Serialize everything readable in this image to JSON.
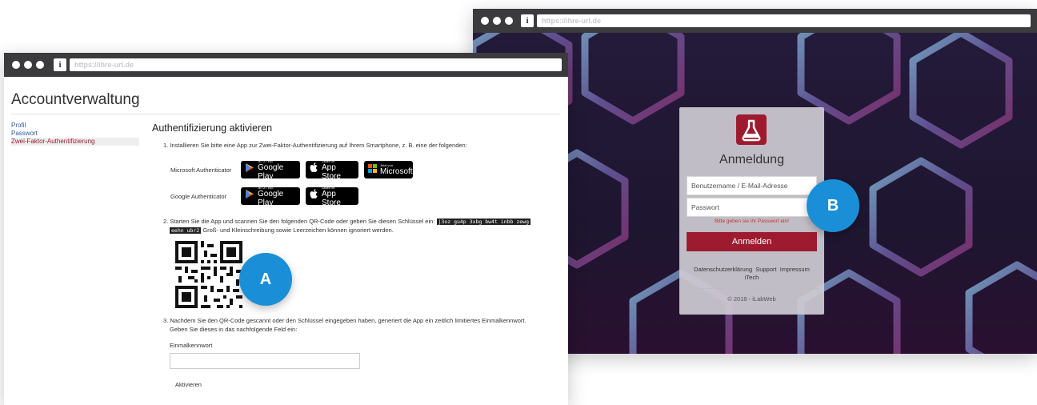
{
  "login_window": {
    "url": "https://ihre-url.de",
    "title": "Anmeldung",
    "username_placeholder": "Benutzername / E-Mail-Adresse",
    "password_placeholder": "Passwort",
    "error": "Bitte geben sie ihr Passwort ein!",
    "submit": "Anmelden",
    "links": [
      "Datenschutzerklärung",
      "Support",
      "Impressum",
      "iTech"
    ],
    "footer": "© 2018 - iLabWeb",
    "icons": [
      "flask-icon"
    ],
    "colors": {
      "brand": "#9e1b2f",
      "background": "#1e1630"
    }
  },
  "account_window": {
    "url": "https://ihre-url.de",
    "page_title": "Accountverwaltung",
    "nav": [
      "Profil",
      "Passwort",
      "Zwei-Faktor-Authentifizierung"
    ],
    "section_title": "Authentifizierung aktivieren",
    "step1": "1. Installieren Sie bitte eine App zur Zwei-Faktor-Authentifizierung auf Ihrem Smartphone, z. B. eine der folgenden:",
    "apps": [
      {
        "label": "Microsoft Authenticator",
        "badges": [
          {
            "small": "JETZT BEI",
            "large": "Google Play",
            "icon": "play-icon"
          },
          {
            "small": "Laden im",
            "large": "App Store",
            "icon": "apple-icon"
          },
          {
            "small": "Jetzt von",
            "large": "Microsoft",
            "icon": "windows-icon"
          }
        ]
      },
      {
        "label": "Google Authenticator",
        "badges": [
          {
            "small": "JETZT BEI",
            "large": "Google Play",
            "icon": "play-icon"
          },
          {
            "small": "Laden im",
            "large": "App Store",
            "icon": "apple-icon"
          }
        ]
      }
    ],
    "step2_prefix": "2. Starten Sie die App und scannen Sie den folgenden QR-Code oder geben Sie diesen Schlüssel ein:",
    "key_part1": "j3oz gu4p 3xbg bw4t inbb zewg",
    "key_part2": "eehn ubr2",
    "step2_suffix": "Groß- und Kleinschreibung sowie Leerzeichen können ignoriert werden.",
    "step3_line1": "3. Nachdem Sie den QR-Code gescannt oder den Schlüssel eingegeben haben, generiert die App ein zeitlich limitiertes Einmalkennwort.",
    "step3_line2": "Geben Sie dieses in das nachfolgende Feld ein:",
    "otp_label": "Einmalkennwort",
    "activate": "Aktivieren"
  },
  "callouts": {
    "a": "A",
    "b": "B",
    "color": "#1a8fd8"
  }
}
